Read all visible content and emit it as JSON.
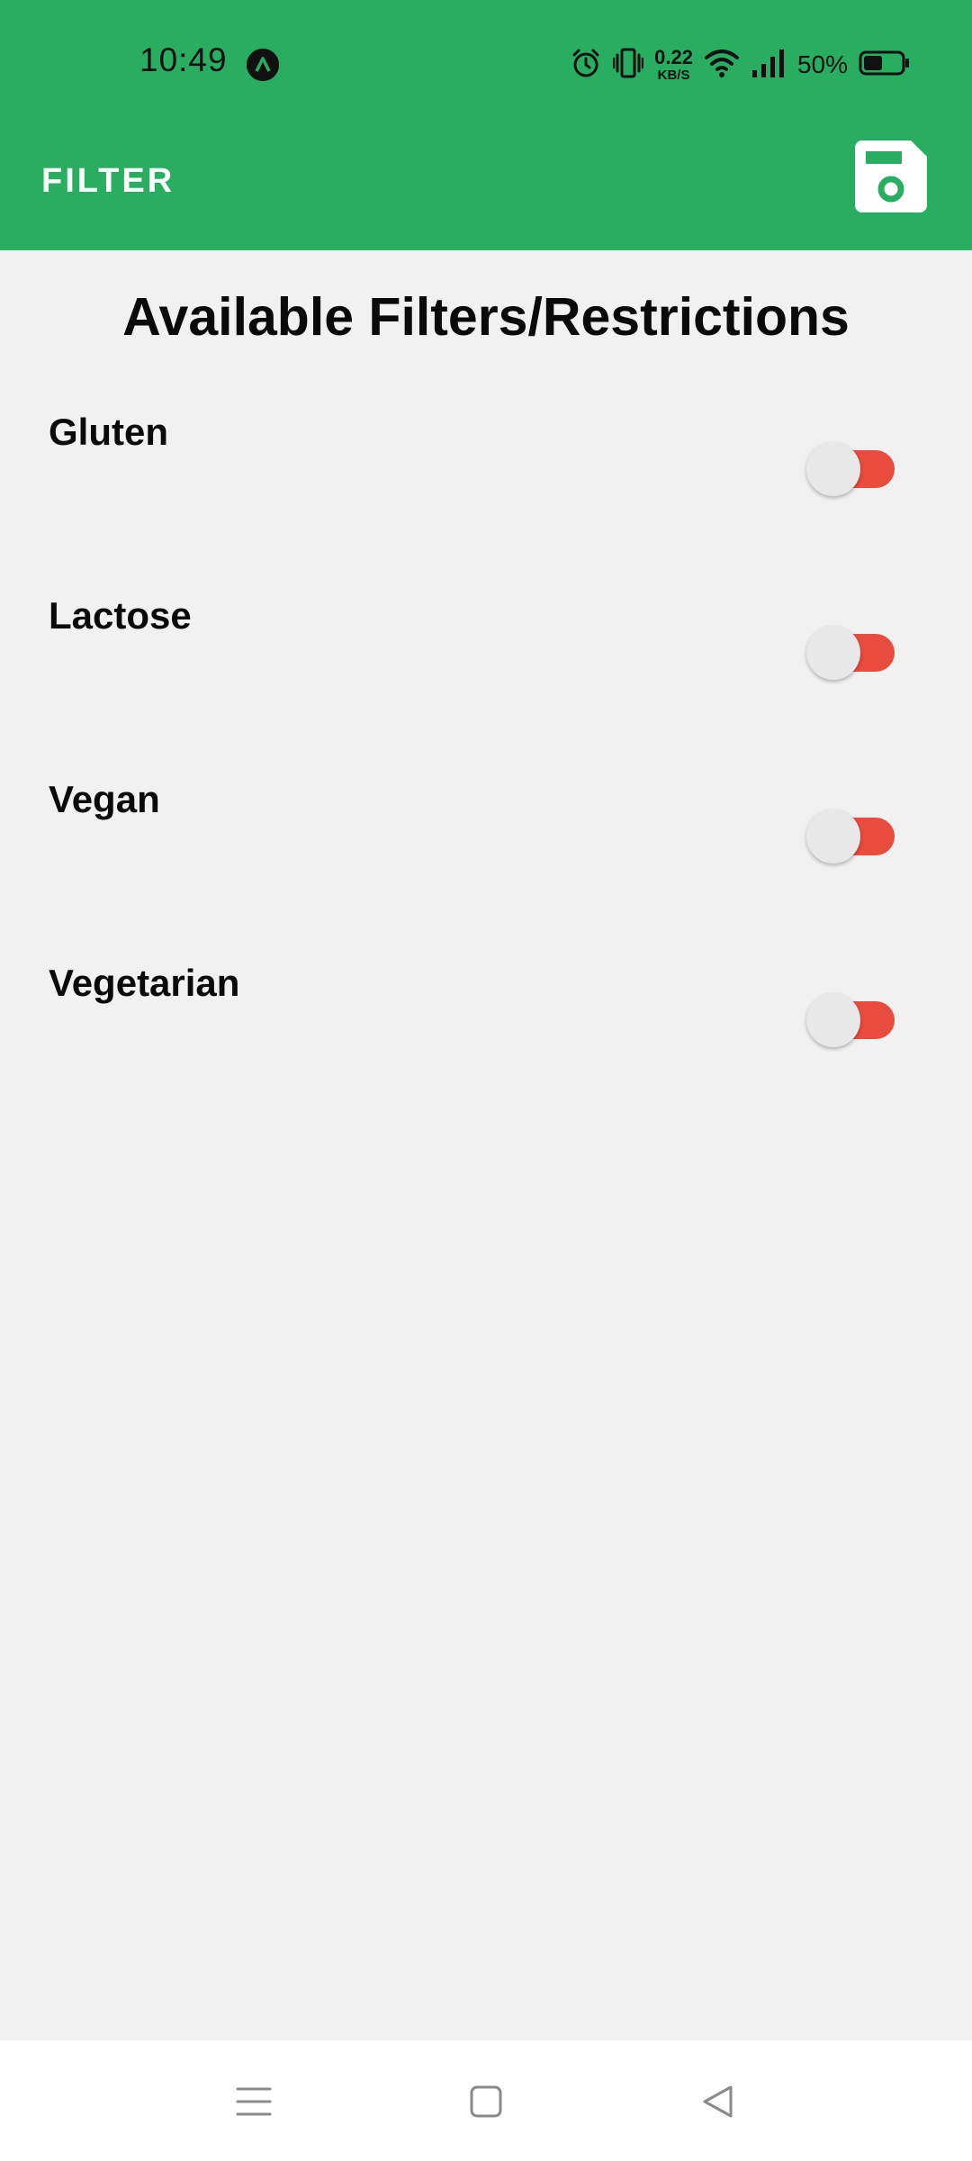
{
  "status_bar": {
    "time": "10:49",
    "network_speed_value": "0.22",
    "network_speed_unit": "KB/S",
    "battery_percent": "50%",
    "battery_level": 0.5,
    "icons": [
      "app-notification-icon",
      "alarm-icon",
      "vibrate-icon",
      "wifi-icon",
      "signal-icon",
      "battery-icon"
    ]
  },
  "app_bar": {
    "title": "FILTER",
    "action_icon": "save-icon"
  },
  "main": {
    "heading": "Available Filters/Restrictions",
    "filters": [
      {
        "label": "Gluten",
        "enabled": false
      },
      {
        "label": "Lactose",
        "enabled": false
      },
      {
        "label": "Vegan",
        "enabled": false
      },
      {
        "label": "Vegetarian",
        "enabled": false
      }
    ]
  },
  "nav_bar": {
    "icons": [
      "menu-icon",
      "home-icon",
      "back-icon"
    ]
  },
  "colors": {
    "primary": "#29ae61",
    "background": "#f2f1f2",
    "switch_track": "#e84c3d",
    "switch_thumb": "#e8e8e8"
  }
}
